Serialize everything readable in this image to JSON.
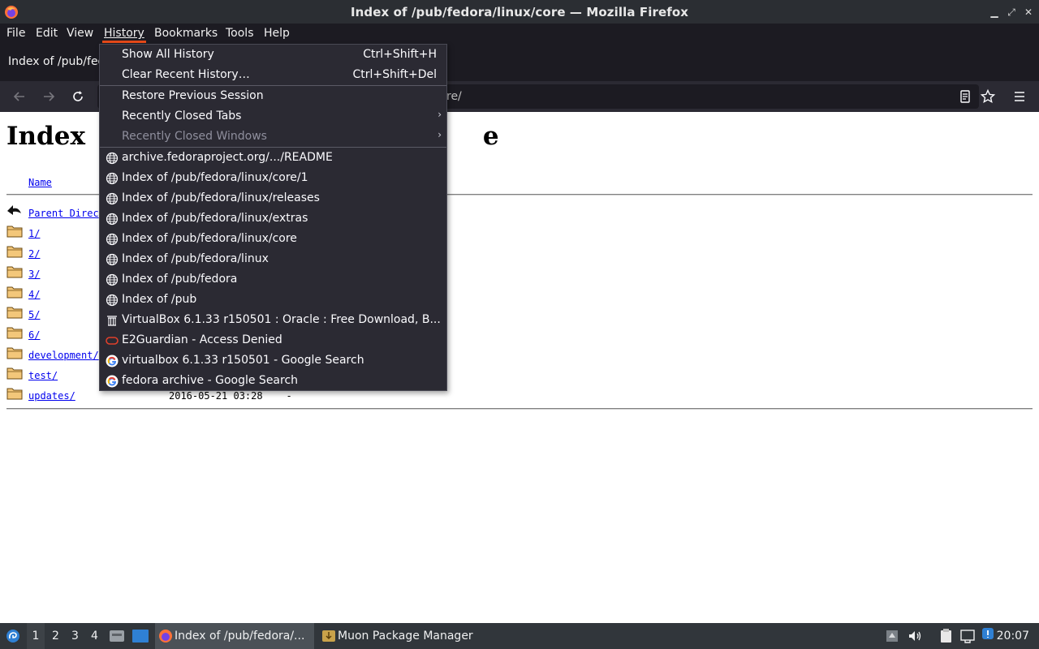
{
  "window": {
    "title": "Index of /pub/fedora/linux/core — Mozilla Firefox"
  },
  "menubar": {
    "items": [
      "File",
      "Edit",
      "View",
      "History",
      "Bookmarks",
      "Tools",
      "Help"
    ],
    "active": "History"
  },
  "tab": {
    "title": "Index of /pub/fed"
  },
  "urlbar": {
    "visible_text": "re/"
  },
  "page": {
    "heading_left": "Index",
    "heading_right": "e",
    "col_name": "Name",
    "rows": [
      {
        "name": "Parent Direc",
        "date": "",
        "icon": "back-arrow-icon"
      },
      {
        "name": "1/",
        "date": "",
        "icon": "folder-icon"
      },
      {
        "name": "2/",
        "date": "",
        "icon": "folder-icon"
      },
      {
        "name": "3/",
        "date": "",
        "icon": "folder-icon"
      },
      {
        "name": "4/",
        "date": "",
        "icon": "folder-icon"
      },
      {
        "name": "5/",
        "date": "",
        "icon": "folder-icon"
      },
      {
        "name": "6/",
        "date": "",
        "icon": "folder-icon"
      },
      {
        "name": "development/",
        "date": "",
        "icon": "folder-icon"
      },
      {
        "name": "test/",
        "date": "",
        "icon": "folder-icon"
      },
      {
        "name": "updates/",
        "date": "2016-05-21 03:28    -",
        "icon": "folder-icon"
      }
    ]
  },
  "history_menu": {
    "show_all": {
      "label": "Show All History",
      "shortcut": "Ctrl+Shift+H"
    },
    "clear_recent": {
      "label": "Clear Recent History…",
      "shortcut": "Ctrl+Shift+Del"
    },
    "restore": {
      "label": "Restore Previous Session"
    },
    "closed_tabs": {
      "label": "Recently Closed Tabs"
    },
    "closed_windows": {
      "label": "Recently Closed Windows"
    },
    "entries": [
      {
        "label": "archive.fedoraproject.org/.../README",
        "icon": "globe-icon"
      },
      {
        "label": "Index of /pub/fedora/linux/core/1",
        "icon": "globe-icon"
      },
      {
        "label": "Index of /pub/fedora/linux/releases",
        "icon": "globe-icon"
      },
      {
        "label": "Index of /pub/fedora/linux/extras",
        "icon": "globe-icon"
      },
      {
        "label": "Index of /pub/fedora/linux/core",
        "icon": "globe-icon"
      },
      {
        "label": "Index of /pub/fedora/linux",
        "icon": "globe-icon"
      },
      {
        "label": "Index of /pub/fedora",
        "icon": "globe-icon"
      },
      {
        "label": "Index of /pub",
        "icon": "globe-icon"
      },
      {
        "label": "VirtualBox 6.1.33 r150501 : Oracle : Free Download, B...",
        "icon": "archive-icon"
      },
      {
        "label": "E2Guardian - Access Denied",
        "icon": "e2guardian-icon"
      },
      {
        "label": "virtualbox 6.1.33 r150501 - Google Search",
        "icon": "google-icon"
      },
      {
        "label": "fedora archive - Google Search",
        "icon": "google-icon"
      }
    ]
  },
  "taskbar": {
    "workspaces": [
      "1",
      "2",
      "3",
      "4"
    ],
    "tasks": [
      {
        "label": "Index of /pub/fedora/...",
        "icon": "firefox-icon"
      },
      {
        "label": "Muon Package Manager",
        "icon": "package-icon"
      }
    ],
    "clock": "20:07"
  },
  "colors": {
    "menu_bg": "#2b2a33",
    "menu_accent": "#e64a19",
    "link": "#0000ee",
    "taskbar_bg": "#31363b"
  }
}
